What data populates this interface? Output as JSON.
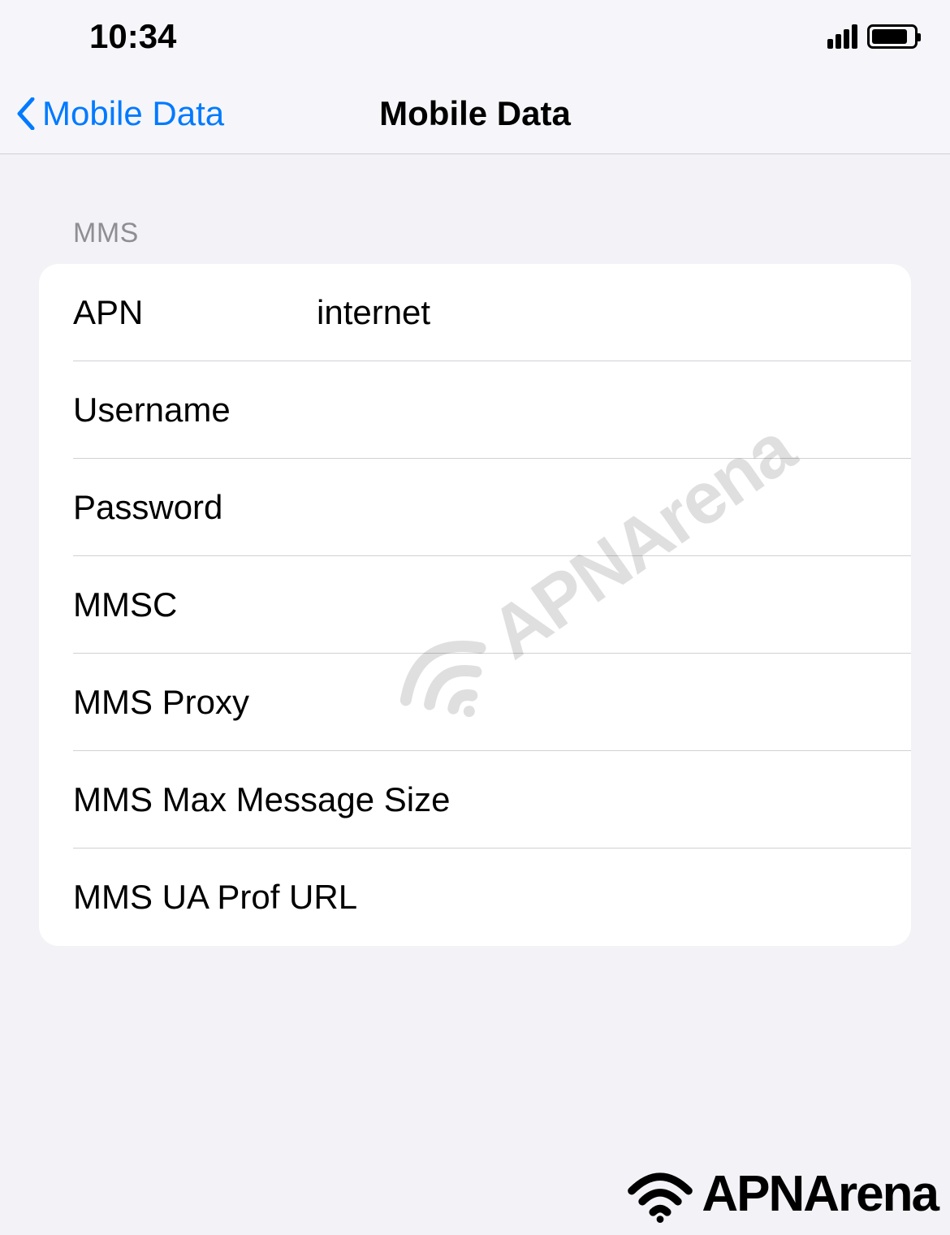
{
  "status_bar": {
    "time": "10:34"
  },
  "nav": {
    "back_label": "Mobile Data",
    "title": "Mobile Data"
  },
  "section": {
    "header": "MMS",
    "rows": [
      {
        "label": "APN",
        "value": "internet"
      },
      {
        "label": "Username",
        "value": ""
      },
      {
        "label": "Password",
        "value": ""
      },
      {
        "label": "MMSC",
        "value": ""
      },
      {
        "label": "MMS Proxy",
        "value": ""
      },
      {
        "label": "MMS Max Message Size",
        "value": ""
      },
      {
        "label": "MMS UA Prof URL",
        "value": ""
      }
    ]
  },
  "watermark": {
    "text": "APNArena"
  },
  "footer": {
    "text": "APNArena"
  }
}
